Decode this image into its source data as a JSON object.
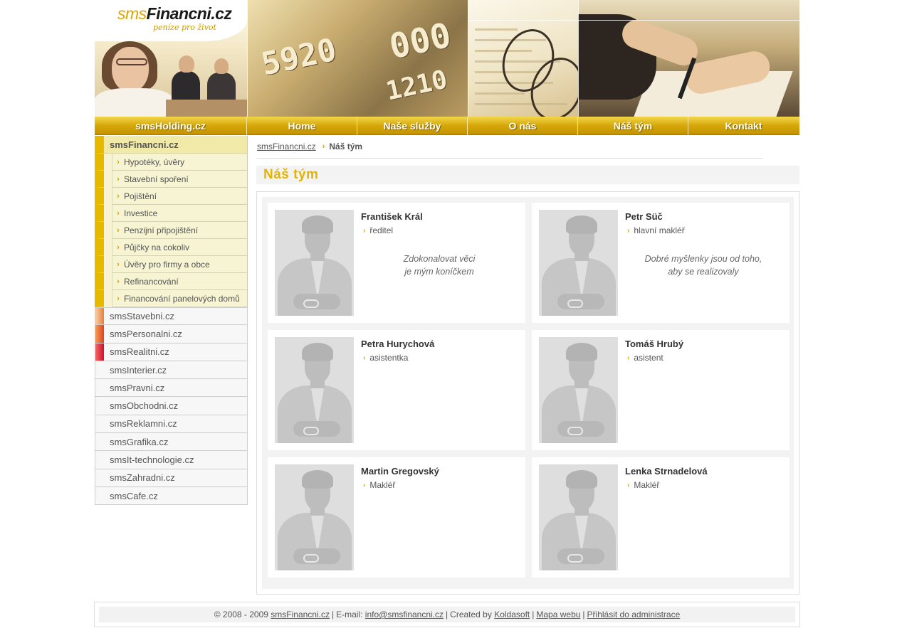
{
  "logo": {
    "prefix": "sms",
    "name": "Financni.cz",
    "slogan": "peníze pro život"
  },
  "header_card_numbers": [
    "5920",
    "000",
    "1210"
  ],
  "nav": [
    {
      "label": "smsHolding.cz"
    },
    {
      "label": "Home"
    },
    {
      "label": "Naše služby"
    },
    {
      "label": "O nás"
    },
    {
      "label": "Náš tým"
    },
    {
      "label": "Kontakt"
    }
  ],
  "sidebar": {
    "active": "smsFinancni.cz",
    "sub_items": [
      "Hypotéky, úvěry",
      "Stavební spoření",
      "Pojištění",
      "Investice",
      "Penzijní připojištění",
      "Půjčky na cokoliv",
      "Úvěry pro firmy a obce",
      "Refinancování",
      "Financování panelových domů"
    ],
    "sites": [
      {
        "label": "smsStavebni.cz",
        "color": "#e8813a"
      },
      {
        "label": "smsPersonalni.cz",
        "color": "#e0461c"
      },
      {
        "label": "smsRealitni.cz",
        "color": "#d0102a"
      },
      {
        "label": "smsInterier.cz",
        "color": ""
      },
      {
        "label": "smsPravni.cz",
        "color": ""
      },
      {
        "label": "smsObchodni.cz",
        "color": ""
      },
      {
        "label": "smsReklamni.cz",
        "color": ""
      },
      {
        "label": "smsGrafika.cz",
        "color": ""
      },
      {
        "label": "smsIt-technologie.cz",
        "color": ""
      },
      {
        "label": "smsZahradni.cz",
        "color": ""
      },
      {
        "label": "smsCafe.cz",
        "color": ""
      }
    ]
  },
  "breadcrumb": {
    "home": "smsFinancni.cz",
    "current": "Náš tým"
  },
  "page_title": "Náš tým",
  "team": [
    {
      "name": "František Král",
      "role": "ředitel",
      "quote_line1": "Zdokonalovat věci",
      "quote_line2": "je mým koníčkem"
    },
    {
      "name": "Petr Süč",
      "role": "hlavní makléř",
      "quote_line1": "Dobré myšlenky jsou od toho,",
      "quote_line2": "aby se realizovaly"
    },
    {
      "name": "Petra Hurychová",
      "role": "asistentka",
      "quote_line1": "",
      "quote_line2": ""
    },
    {
      "name": "Tomáš Hrubý",
      "role": "asistent",
      "quote_line1": "",
      "quote_line2": ""
    },
    {
      "name": "Martin Gregovský",
      "role": "Makléř",
      "quote_line1": "",
      "quote_line2": ""
    },
    {
      "name": "Lenka Strnadelová",
      "role": "Makléř",
      "quote_line1": "",
      "quote_line2": ""
    }
  ],
  "footer": {
    "copyright": "© 2008 - 2009",
    "site_link": "smsFinancni.cz",
    "email_label": "E-mail:",
    "email": "info@smsfinancni.cz",
    "created_by": "Created by",
    "author": "Koldasoft",
    "sitemap": "Mapa webu",
    "admin": "Přihlásit do administrace",
    "sep": "|"
  },
  "colors": {
    "accent": "#e5b400",
    "nav_gold": "#d6a80a",
    "sidebar_active_bg": "#f0e9a7"
  }
}
